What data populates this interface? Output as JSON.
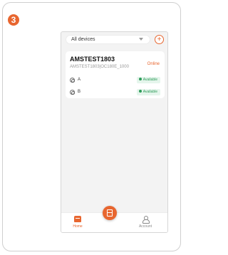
{
  "step_number": "3",
  "header": {
    "selector_value": "All devices",
    "selector_icon": "chevron-down-icon",
    "add_icon": "plus-icon",
    "add_symbol": "+"
  },
  "device": {
    "name": "AMSTEST1803",
    "model": "AMSTEST1803|OC180E_1000",
    "status": "Online",
    "slots": [
      {
        "label": "A",
        "status": "Available"
      },
      {
        "label": "B",
        "status": "Available"
      }
    ]
  },
  "nav": {
    "home_label": "Home",
    "account_label": "Account",
    "center_icon": "device-icon"
  },
  "colors": {
    "accent": "#e8662f",
    "available_text": "#2e9c5a",
    "available_bg": "#e5f5ec"
  }
}
